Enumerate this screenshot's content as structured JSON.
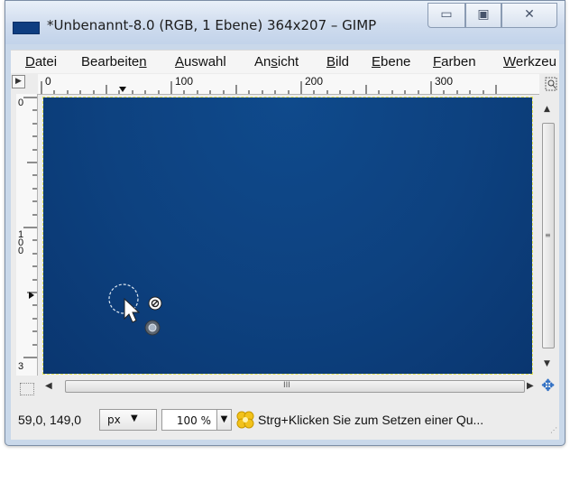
{
  "window": {
    "title": "*Unbenannt-8.0 (RGB, 1 Ebene) 364x207 – GIMP",
    "controls": {
      "minimize": "▭",
      "maximize": "▣",
      "close": "✕"
    }
  },
  "menu": {
    "items": [
      {
        "u": "D",
        "rest": "atei"
      },
      {
        "pre": "Bearbeite",
        "u": "n",
        "rest": ""
      },
      {
        "u": "A",
        "rest": "uswahl"
      },
      {
        "pre": "An",
        "u": "s",
        "rest": "icht"
      },
      {
        "u": "B",
        "rest": "ild"
      },
      {
        "u": "E",
        "rest": "bene"
      },
      {
        "u": "F",
        "rest": "arben"
      },
      {
        "u": "W",
        "rest": "erkzeu"
      }
    ]
  },
  "ruler": {
    "h_labels": [
      "0",
      "100",
      "200",
      "300"
    ],
    "v_labels": [
      "0",
      "100",
      "3"
    ]
  },
  "canvas": {
    "color": "#0d417f"
  },
  "status": {
    "coords": "59,0, 149,0",
    "unit": "px",
    "zoom": "100 %",
    "hint": "Strg+Klicken Sie zum Setzen einer Qu..."
  },
  "icons": {
    "canvas_menu": "triangle-right-icon",
    "navigate": "navigate-icon",
    "quick_mask": "quick-mask-icon",
    "move": "move-arrows-icon",
    "hint": "clone-tool-icon"
  }
}
